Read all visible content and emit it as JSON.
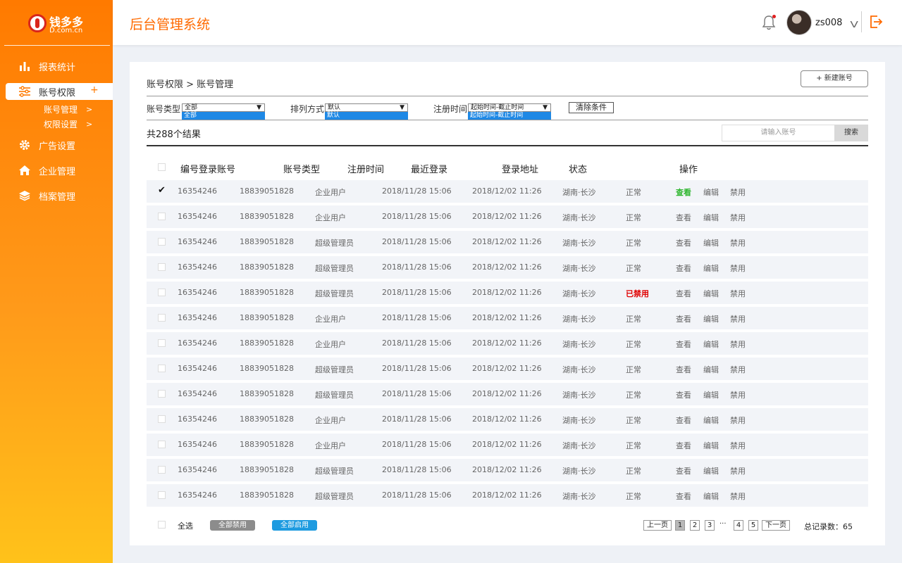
{
  "brand": {
    "name": "钱多多",
    "domain": "D.com.cn",
    "accent": "#ff7a00"
  },
  "header": {
    "title": "后台管理系统",
    "username": "zs008",
    "chevron": "V"
  },
  "sidebar": {
    "items": [
      {
        "label": "报表统计",
        "icon": "bar-chart-icon"
      },
      {
        "label": "账号权限",
        "icon": "sliders-icon",
        "active": true,
        "expand": "+"
      },
      {
        "label": "广告设置",
        "icon": "gear-icon"
      },
      {
        "label": "企业管理",
        "icon": "home-icon"
      },
      {
        "label": "档案管理",
        "icon": "layers-icon"
      }
    ],
    "subitems": [
      {
        "label": "账号管理",
        "arrow": ">"
      },
      {
        "label": "权限设置",
        "arrow": ">"
      }
    ]
  },
  "main": {
    "breadcrumb": "账号权限 > 账号管理",
    "new_button": "+  新建账号",
    "filters": {
      "type_label": "账号类型",
      "type_value": "全部",
      "type_option": "全部",
      "sort_label": "排列方式",
      "sort_value": "默认",
      "sort_option": "默认",
      "date_label": "注册时间",
      "date_value": "起始时间-截止时间",
      "date_option": "起始时间-截止时间",
      "clear_button": "清除条件",
      "arrow": "▼"
    },
    "results": "共288个结果",
    "search_placeholder": "请输入账号",
    "search_button": "搜索",
    "columns": [
      "编号登录账号",
      "账号类型",
      "注册时间",
      "最近登录",
      "登录地址",
      "状态",
      "操作"
    ],
    "check_mark": "✔",
    "rows": [
      {
        "id": "16354246",
        "account": "18839051828",
        "type": "企业用户",
        "reg": "2018/11/28 15:06",
        "last": "2018/12/02 11:26",
        "addr": "湖南·长沙",
        "status": "正常",
        "view": "查看",
        "edit": "编辑",
        "ban": "禁用",
        "checked": true
      },
      {
        "id": "16354246",
        "account": "18839051828",
        "type": "企业用户",
        "reg": "2018/11/28 15:06",
        "last": "2018/12/02 11:26",
        "addr": "湖南·长沙",
        "status": "正常",
        "view": "查看",
        "edit": "编辑",
        "ban": "禁用"
      },
      {
        "id": "16354246",
        "account": "18839051828",
        "type": "超级管理员",
        "reg": "2018/11/28 15:06",
        "last": "2018/12/02 11:26",
        "addr": "湖南·长沙",
        "status": "正常",
        "view": "查看",
        "edit": "编辑",
        "ban": "禁用"
      },
      {
        "id": "16354246",
        "account": "18839051828",
        "type": "超级管理员",
        "reg": "2018/11/28 15:06",
        "last": "2018/12/02 11:26",
        "addr": "湖南·长沙",
        "status": "正常",
        "view": "查看",
        "edit": "编辑",
        "ban": "禁用"
      },
      {
        "id": "16354246",
        "account": "18839051828",
        "type": "超级管理员",
        "reg": "2018/11/28 15:06",
        "last": "2018/12/02 11:26",
        "addr": "湖南·长沙",
        "status": "已禁用",
        "view": "查看",
        "edit": "编辑",
        "ban": "禁用"
      },
      {
        "id": "16354246",
        "account": "18839051828",
        "type": "企业用户",
        "reg": "2018/11/28 15:06",
        "last": "2018/12/02 11:26",
        "addr": "湖南·长沙",
        "status": "正常",
        "view": "查看",
        "edit": "编辑",
        "ban": "禁用"
      },
      {
        "id": "16354246",
        "account": "18839051828",
        "type": "企业用户",
        "reg": "2018/11/28 15:06",
        "last": "2018/12/02 11:26",
        "addr": "湖南·长沙",
        "status": "正常",
        "view": "查看",
        "edit": "编辑",
        "ban": "禁用"
      },
      {
        "id": "16354246",
        "account": "18839051828",
        "type": "超级管理员",
        "reg": "2018/11/28 15:06",
        "last": "2018/12/02 11:26",
        "addr": "湖南·长沙",
        "status": "正常",
        "view": "查看",
        "edit": "编辑",
        "ban": "禁用"
      },
      {
        "id": "16354246",
        "account": "18839051828",
        "type": "超级管理员",
        "reg": "2018/11/28 15:06",
        "last": "2018/12/02 11:26",
        "addr": "湖南·长沙",
        "status": "正常",
        "view": "查看",
        "edit": "编辑",
        "ban": "禁用"
      },
      {
        "id": "16354246",
        "account": "18839051828",
        "type": "企业用户",
        "reg": "2018/11/28 15:06",
        "last": "2018/12/02 11:26",
        "addr": "湖南·长沙",
        "status": "正常",
        "view": "查看",
        "edit": "编辑",
        "ban": "禁用"
      },
      {
        "id": "16354246",
        "account": "18839051828",
        "type": "企业用户",
        "reg": "2018/11/28 15:06",
        "last": "2018/12/02 11:26",
        "addr": "湖南·长沙",
        "status": "正常",
        "view": "查看",
        "edit": "编辑",
        "ban": "禁用"
      },
      {
        "id": "16354246",
        "account": "18839051828",
        "type": "超级管理员",
        "reg": "2018/11/28 15:06",
        "last": "2018/12/02 11:26",
        "addr": "湖南·长沙",
        "status": "正常",
        "view": "查看",
        "edit": "编辑",
        "ban": "禁用"
      },
      {
        "id": "16354246",
        "account": "18839051828",
        "type": "超级管理员",
        "reg": "2018/11/28 15:06",
        "last": "2018/12/02 11:26",
        "addr": "湖南·长沙",
        "status": "正常",
        "view": "查看",
        "edit": "编辑",
        "ban": "禁用"
      }
    ],
    "footer": {
      "select_all": "全选",
      "disable_all": "全部禁用",
      "enable_all": "全部启用",
      "prev": "上一页",
      "pages": [
        "1",
        "2",
        "3",
        "4",
        "5"
      ],
      "ellipsis": "···",
      "next": "下一页",
      "total": "总记录数：65",
      "colors": {
        "disable_all": "#8c8c8c",
        "enable_all": "#1e9be0",
        "disabled_status": "#e00000",
        "view_active": "#2fb62f"
      }
    }
  }
}
